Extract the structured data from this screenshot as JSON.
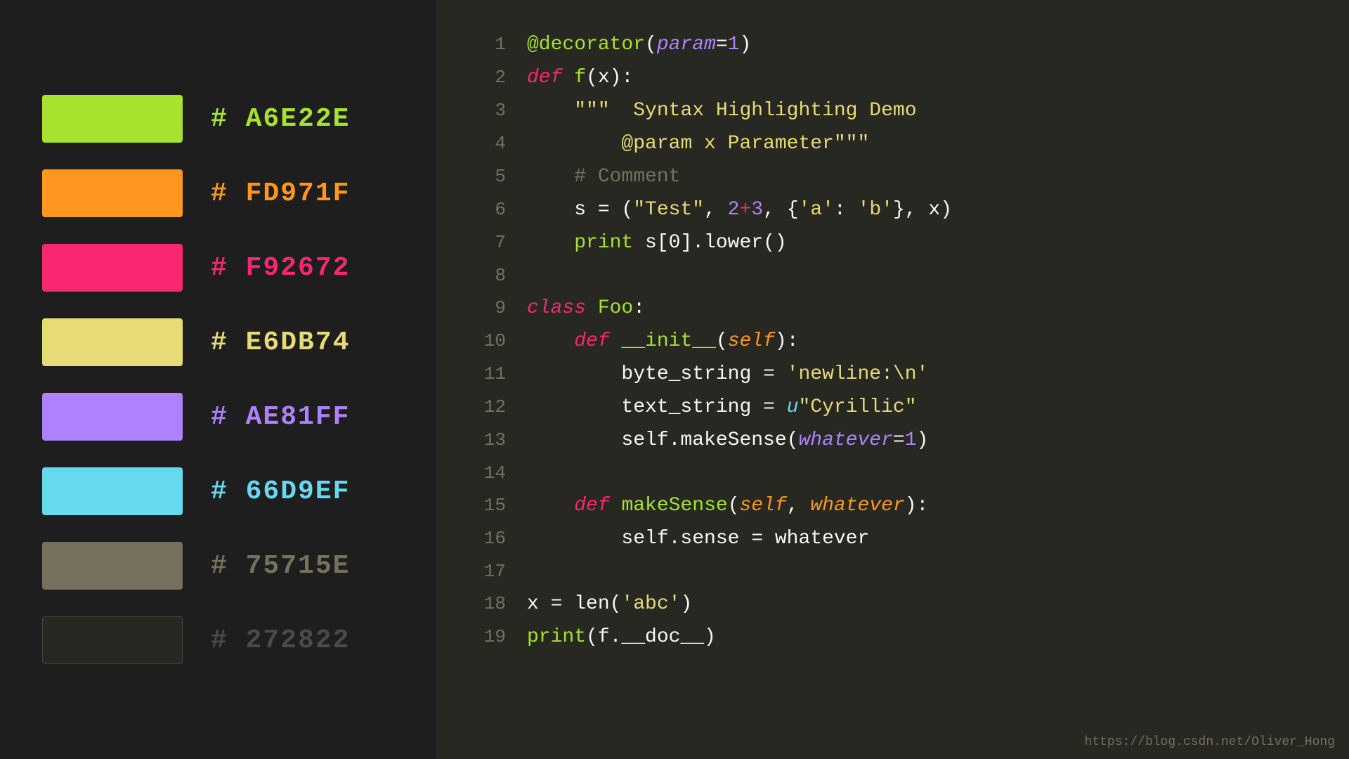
{
  "colors": [
    {
      "hex": "#A6E22E",
      "label": "# A6E22E"
    },
    {
      "hex": "#FD971F",
      "label": "# FD971F"
    },
    {
      "hex": "#F92672",
      "label": "# F92672"
    },
    {
      "hex": "#E6DB74",
      "label": "# E6DB74"
    },
    {
      "hex": "#AE81FF",
      "label": "# AE81FF"
    },
    {
      "hex": "#66D9EF",
      "label": "# 66D9EF"
    },
    {
      "hex": "#75715E",
      "label": "# 75715E"
    },
    {
      "hex": "#272822",
      "label": "# 272822"
    }
  ],
  "watermark": "https://blog.csdn.net/Oliver_Hong"
}
